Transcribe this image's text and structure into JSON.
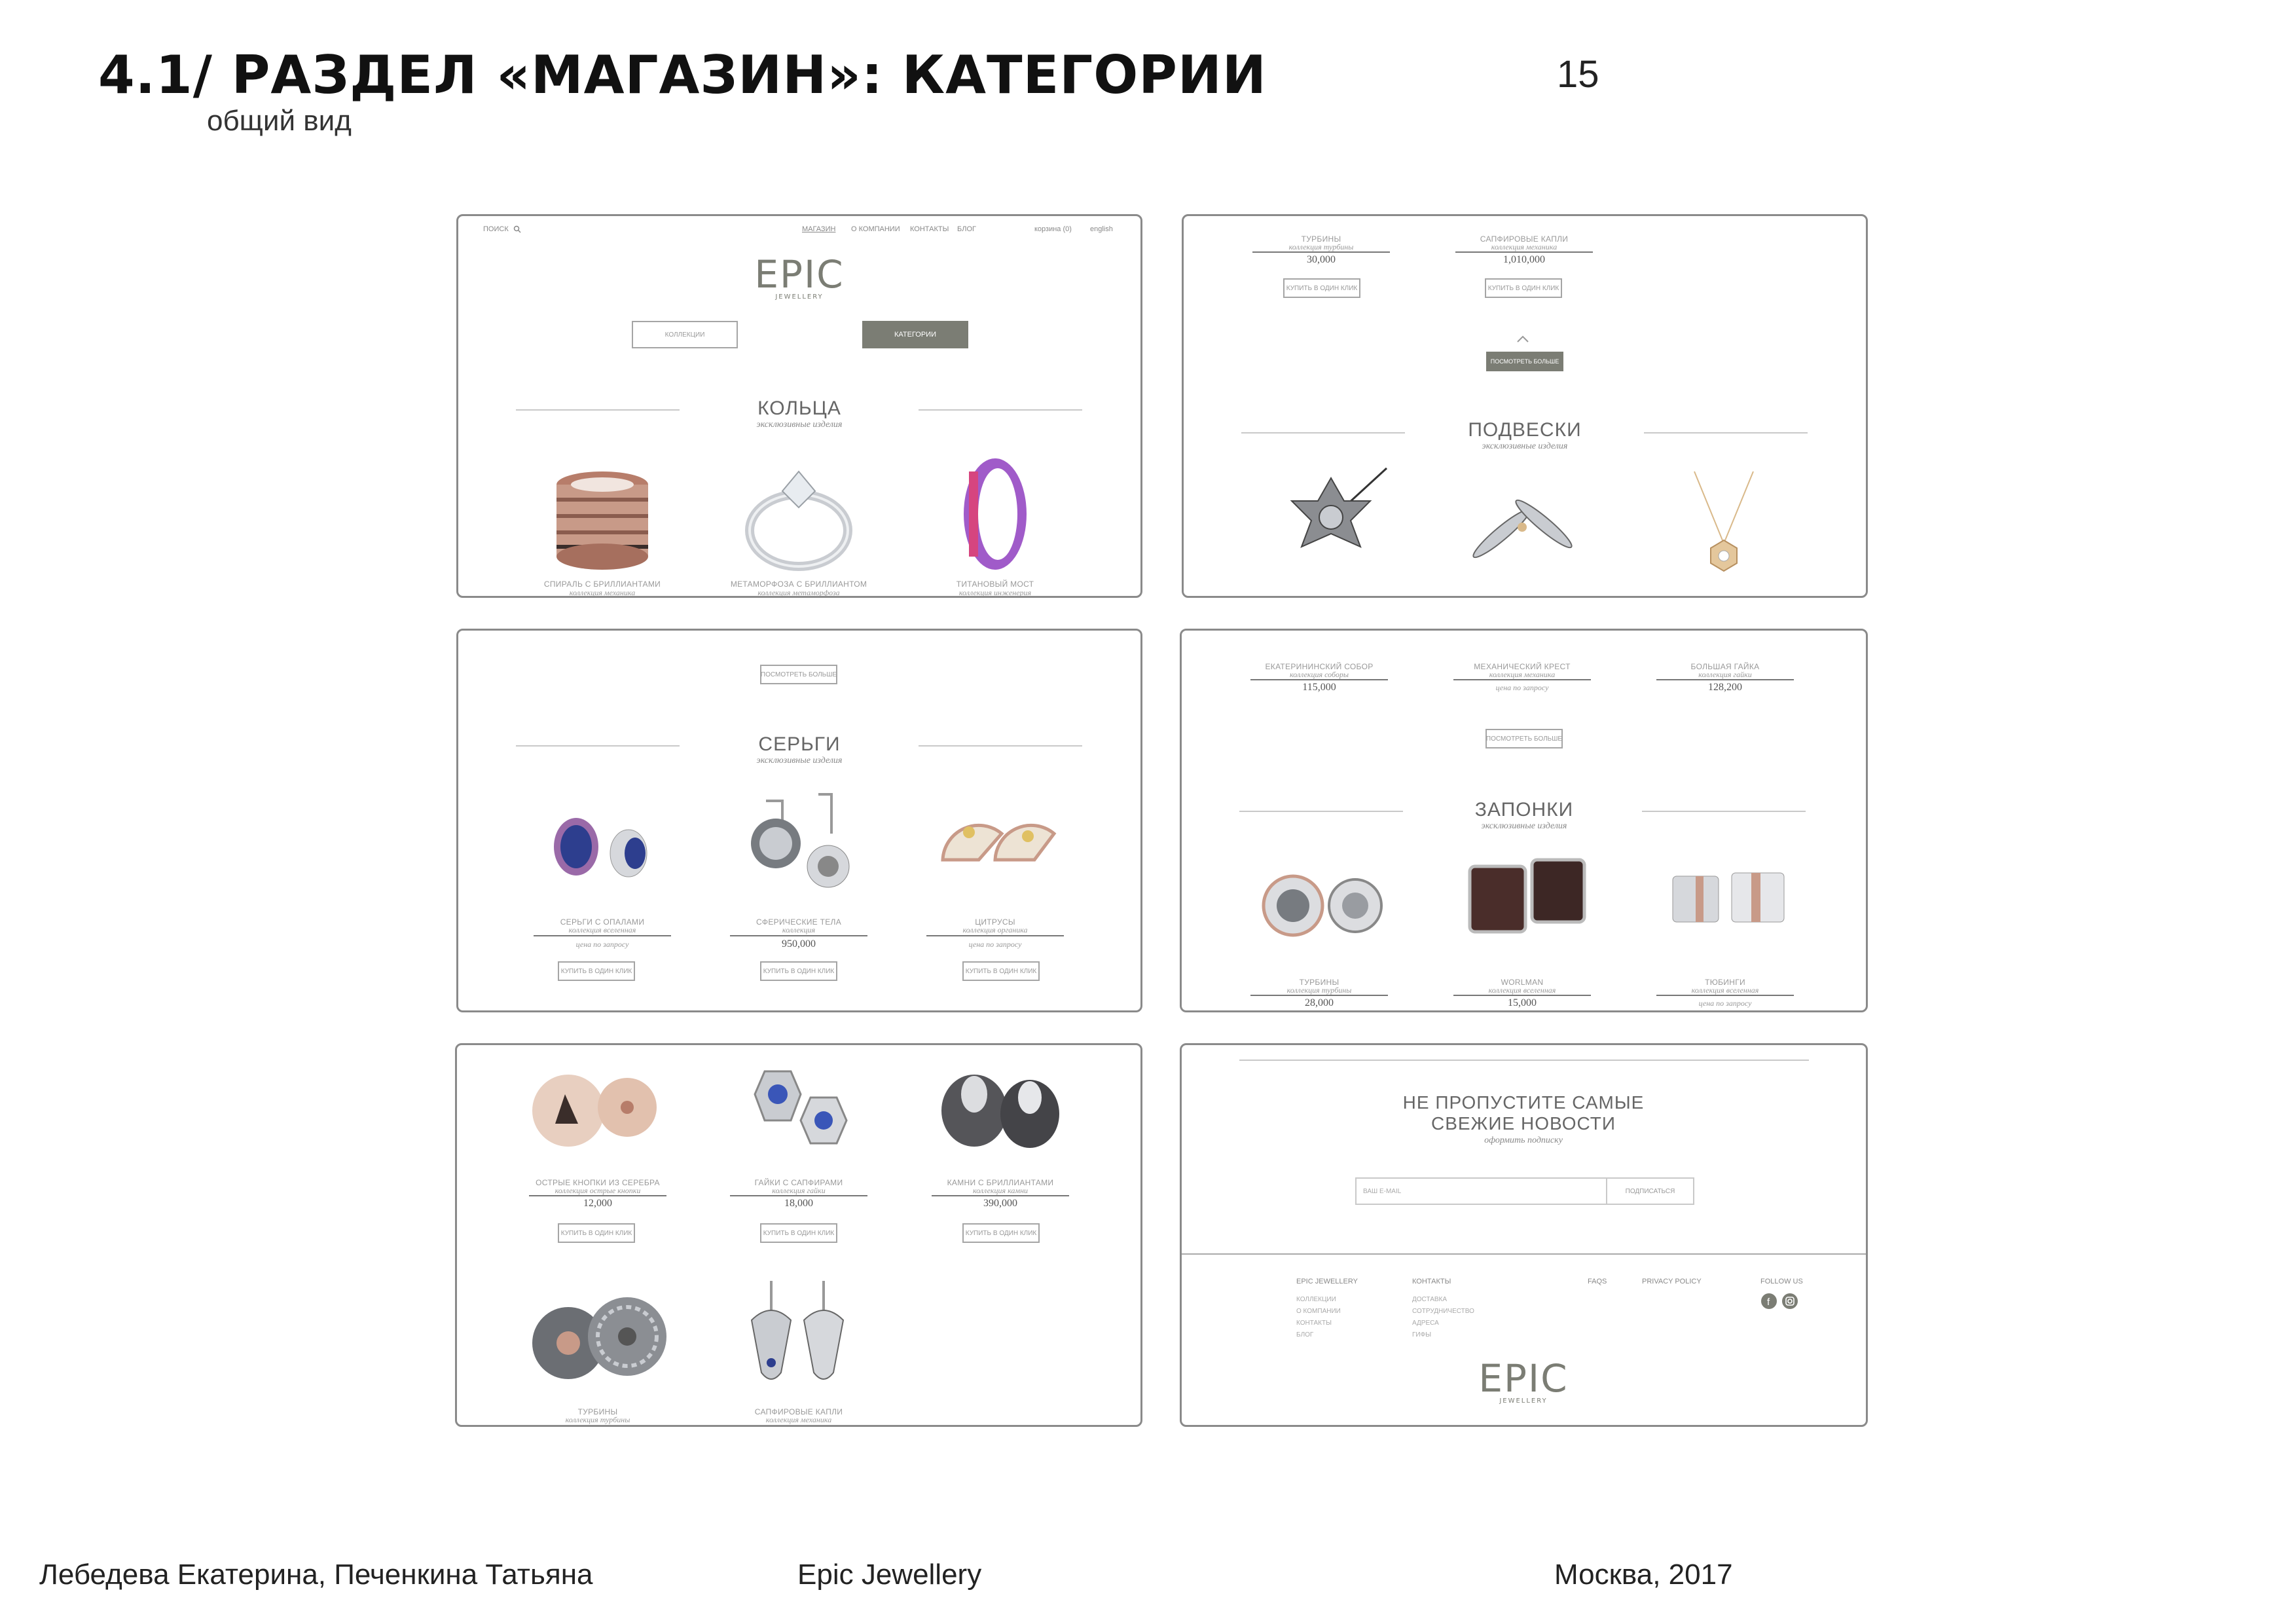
{
  "slide": {
    "title": "4.1/ РАЗДЕЛ «МАГАЗИН»: КАТЕГОРИИ",
    "subtitle": "общий вид",
    "page_number": "15"
  },
  "footer": {
    "authors": "Лебедева Екатерина, Печенкина Татьяна",
    "project": "Epic Jewellery",
    "place_year": "Москва, 2017"
  },
  "site": {
    "search_label": "поиск",
    "nav": [
      "МАГАЗИН",
      "О КОМПАНИИ",
      "КОНТАКТЫ",
      "БЛОГ"
    ],
    "cart_label": "корзина (0)",
    "lang_label": "english",
    "logo": "EPIC",
    "logo_sub": "JEWELLERY",
    "btn_collections": "КОЛЛЕКЦИИ",
    "btn_categories": "КАТЕГОРИИ",
    "btn_more": "ПОСМОТРЕТЬ БОЛЬШЕ",
    "btn_buy": "КУПИТЬ В ОДИН КЛИК",
    "section_sub": "эксклюзивные изделия",
    "price_on_request": "цена по запросу"
  },
  "rings": {
    "title": "КОЛЬЦА",
    "items": [
      {
        "name": "СПИРАЛЬ С БРИЛЛИАНТАМИ",
        "collection": "коллекция механика"
      },
      {
        "name": "МЕТАМОРФОЗА С БРИЛЛИАНТОМ",
        "collection": "коллекция метаморфоза"
      },
      {
        "name": "ТИТАНОВЫЙ МОСТ",
        "collection": "коллекция инженерия"
      }
    ]
  },
  "panel2_top": [
    {
      "name": "ТУРБИНЫ",
      "collection": "коллекция турбины",
      "price": "30,000"
    },
    {
      "name": "САПФИРОВЫЕ КАПЛИ",
      "collection": "коллекция механика",
      "price": "1,010,000"
    }
  ],
  "pendants": {
    "title": "ПОДВЕСКИ"
  },
  "earrings": {
    "title": "СЕРЬГИ",
    "items": [
      {
        "name": "СЕРЬГИ С ОПАЛАМИ",
        "collection": "коллекция вселенная",
        "price": "цена по запросу"
      },
      {
        "name": "СФЕРИЧЕСКИЕ ТЕЛА",
        "collection": "коллекция",
        "price": "950,000"
      },
      {
        "name": "ЦИТРУСЫ",
        "collection": "коллекция органика",
        "price": "цена по запросу"
      }
    ]
  },
  "panel4_top": [
    {
      "name": "ЕКАТЕРИНИНСКИЙ СОБОР",
      "collection": "коллекция соборы",
      "price": "115,000"
    },
    {
      "name": "МЕХАНИЧЕСКИЙ КРЕСТ",
      "collection": "коллекция механика",
      "price": "цена по запросу"
    },
    {
      "name": "БОЛЬШАЯ ГАЙКА",
      "collection": "коллекция гайки",
      "price": "128,200"
    }
  ],
  "cufflinks": {
    "title": "ЗАПОНКИ",
    "items": [
      {
        "name": "ТУРБИНЫ",
        "collection": "коллекция турбины",
        "price": "28,000"
      },
      {
        "name": "WORLMAN",
        "collection": "коллекция вселенная",
        "price": "15,000"
      },
      {
        "name": "ТЮБИНГИ",
        "collection": "коллекция вселенная",
        "price": "цена по запросу"
      }
    ]
  },
  "panel5": [
    {
      "name": "ОСТРЫЕ КНОПКИ ИЗ СЕРЕБРА",
      "collection": "коллекция острые кнопки",
      "price": "12,000"
    },
    {
      "name": "ГАЙКИ С САПФИРАМИ",
      "collection": "коллекция гайки",
      "price": "18,000"
    },
    {
      "name": "КАМНИ С БРИЛЛИАНТАМИ",
      "collection": "коллекция камни",
      "price": "390,000"
    },
    {
      "name": "ТУРБИНЫ",
      "collection": "коллекция турбины"
    },
    {
      "name": "САПФИРОВЫЕ КАПЛИ",
      "collection": "коллекция механика"
    }
  ],
  "newsletter": {
    "title_line1": "НЕ ПРОПУСТИТЕ САМЫЕ",
    "title_line2": "СВЕЖИЕ НОВОСТИ",
    "subtitle": "оформить подписку",
    "email_placeholder": "ВАШ E-MAIL",
    "subscribe_label": "ПОДПИСАТЬСЯ"
  },
  "site_footer": {
    "col1_title": "EPIC JEWELLERY",
    "col1_links": [
      "КОЛЛЕКЦИИ",
      "О КОМПАНИИ",
      "КОНТАКТЫ",
      "БЛОГ"
    ],
    "col2_title": "КОНТАКТЫ",
    "col2_links": [
      "ДОСТАВКА",
      "СОТРУДНИЧЕСТВО",
      "АДРЕСА",
      "ГИФЫ"
    ],
    "faqs": "FAQS",
    "privacy": "PRIVACY POLICY",
    "follow": "FOLLOW US"
  },
  "colors": {
    "accent": "#7b7d74",
    "border": "#8a8a8a",
    "rose_gold": "#c89a88",
    "silver": "#c9ccd1",
    "titanium_purple": "#a05bc9",
    "gold": "#d9b98a",
    "dark_metal": "#555555"
  }
}
